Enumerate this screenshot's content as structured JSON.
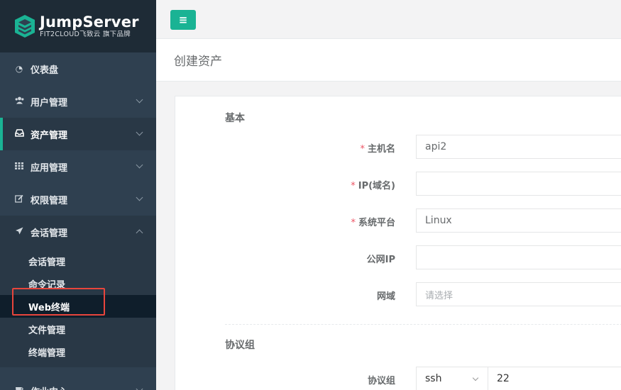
{
  "brand": {
    "name": "JumpServer",
    "tagline": "FIT2CLOUD飞致云 旗下品牌"
  },
  "colors": {
    "sidebar_bg": "#2f4050",
    "accent": "#1ab394",
    "required": "#ed5565",
    "annotation": "#e8453c"
  },
  "sidebar": {
    "items": [
      {
        "label": "仪表盘",
        "icon": "dashboard-icon"
      },
      {
        "label": "用户管理",
        "icon": "users-icon"
      },
      {
        "label": "资产管理",
        "icon": "inbox-icon"
      },
      {
        "label": "应用管理",
        "icon": "grid-icon"
      },
      {
        "label": "权限管理",
        "icon": "edit-icon"
      },
      {
        "label": "会话管理",
        "icon": "rocket-icon"
      }
    ],
    "submenu": [
      {
        "label": "会话管理"
      },
      {
        "label": "命令记录"
      },
      {
        "label": "Web终端"
      },
      {
        "label": "文件管理"
      },
      {
        "label": "终端管理"
      }
    ],
    "bottom_item": {
      "label": "作业中心",
      "icon": "coffee-icon"
    }
  },
  "toolbar": {
    "menu_icon": "hamburger-icon",
    "menu_glyph": "≡"
  },
  "page": {
    "title": "创建资产"
  },
  "form": {
    "basic_section": "基本",
    "fields": {
      "hostname": {
        "label": "主机名",
        "value": "api2",
        "required": "*"
      },
      "ip": {
        "label": "IP(域名)",
        "value": "",
        "required": "*"
      },
      "platform": {
        "label": "系统平台",
        "value": "Linux",
        "required": "*"
      },
      "public_ip": {
        "label": "公网IP",
        "value": ""
      },
      "domain": {
        "label": "网域",
        "placeholder": "请选择"
      }
    },
    "protocol_section": "协议组",
    "protocol": {
      "label": "协议组",
      "selected": "ssh",
      "port": "22"
    }
  }
}
